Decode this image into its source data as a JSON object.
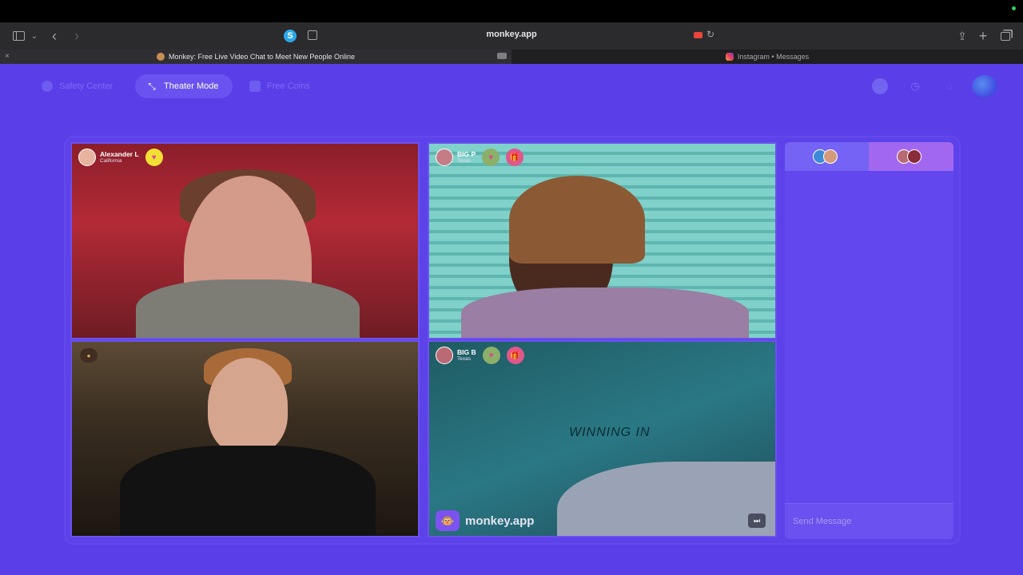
{
  "browser": {
    "url": "monkey.app",
    "tabs": [
      {
        "label": "Monkey: Free Live Video Chat to Meet New People Online"
      },
      {
        "label": "Instagram • Messages"
      }
    ],
    "extension_letter": "S"
  },
  "nav": {
    "safety_center": "Safety Center",
    "theater_mode": "Theater Mode",
    "free_coins": "Free Coins"
  },
  "tiles": [
    {
      "name": "Alexander L",
      "location": "California"
    },
    {
      "name": "BIG P",
      "location": "Texas"
    },
    {
      "name": "",
      "location": ""
    },
    {
      "name": "BIG B",
      "location": "Texas"
    }
  ],
  "watermark": "monkey.app",
  "chat": {
    "placeholder": "Send Message"
  },
  "colors": {
    "page_bg": "#5a3ee8",
    "accent": "#6a52f0"
  }
}
